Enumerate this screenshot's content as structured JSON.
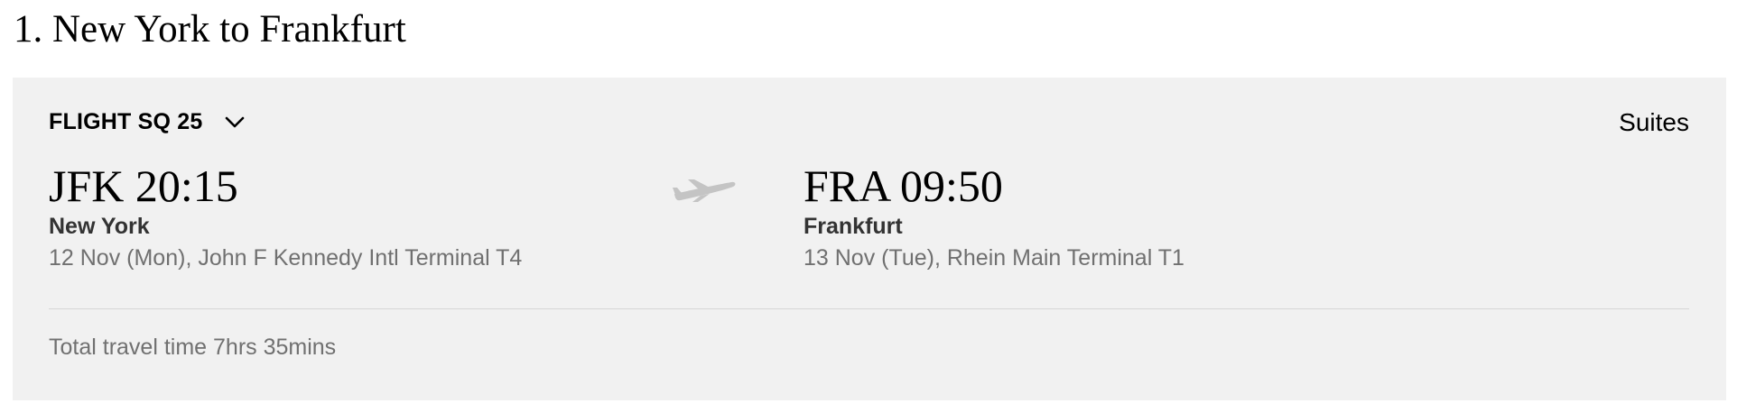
{
  "leg": {
    "title": "1. New York to Frankfurt"
  },
  "flight": {
    "label": "FLIGHT SQ 25",
    "toggle_icon": "chevron-down-icon",
    "cabin": "Suites"
  },
  "departure": {
    "time": "JFK 20:15",
    "city": "New York",
    "detail": "12 Nov (Mon), John F Kennedy Intl Terminal T4"
  },
  "route_icon": "airplane-icon",
  "arrival": {
    "time": "FRA 09:50",
    "city": "Frankfurt",
    "detail": "13 Nov (Tue), Rhein Main Terminal T1"
  },
  "summary": {
    "total_travel_time": "Total travel time 7hrs 35mins"
  },
  "colors": {
    "card_background": "#f1f1f1",
    "muted_text": "#707070",
    "divider": "#d6d6d6",
    "plane_icon": "#c4c4c4"
  }
}
